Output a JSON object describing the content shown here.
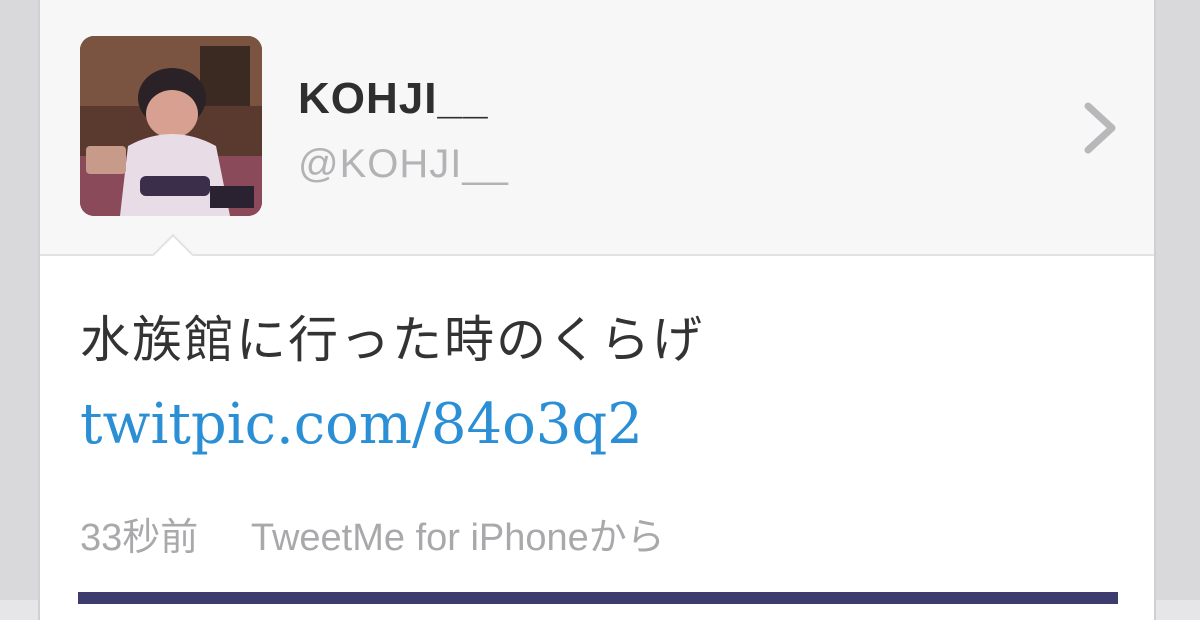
{
  "profile": {
    "display_name": "KOHJI__",
    "handle": "@KOHJI__",
    "avatar_icon": "user-photo",
    "chevron_icon": "chevron-right-icon"
  },
  "tweet": {
    "text": "水族館に行った時のくらげ",
    "link": "twitpic.com/84o3q2",
    "time": "33秒前",
    "source": "TweetMe for iPhoneから"
  },
  "colors": {
    "link": "#2b8fd6",
    "name": "#2f2f2f",
    "muted": "#a9a9ac"
  }
}
